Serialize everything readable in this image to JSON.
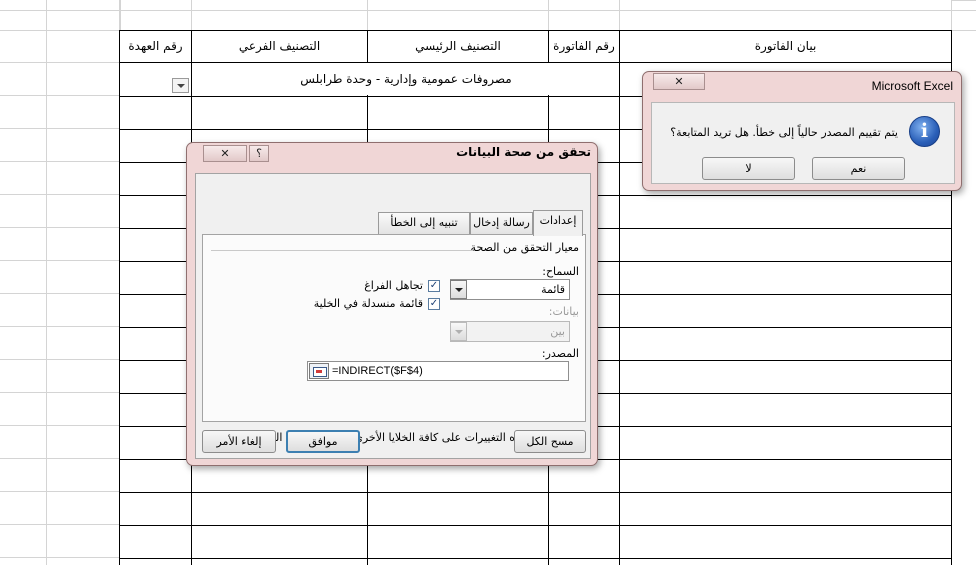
{
  "sheet": {
    "headers": {
      "custody_no": "رقم العهدة",
      "sub_category": "التصنيف الفرعي",
      "main_category": "التصنيف الرئيسي",
      "invoice_no": "رقم الفاتورة",
      "invoice_desc": "بيان الفاتورة"
    },
    "merged_cell_value": "مصروفات عمومية وإدارية - وحدة طرابلس"
  },
  "data_validation_dialog": {
    "title": "تحقق من صحة البيانات",
    "help_glyph": "؟",
    "close_glyph": "✕",
    "tabs": [
      {
        "label": "إعدادات",
        "active": true
      },
      {
        "label": "رسالة إدخال",
        "active": false
      },
      {
        "label": "تنبيه إلى الخطأ",
        "active": false
      }
    ],
    "criteria_heading": "معيار التحقق من الصحة",
    "allow_label": "السماح:",
    "allow_value": "قائمة",
    "ignore_blank_label": "تجاهل الفراغ",
    "ignore_blank_checked": true,
    "in_cell_dropdown_label": "قائمة منسدلة في الخلية",
    "in_cell_dropdown_checked": true,
    "data_label": "بيانات:",
    "data_value": "بين",
    "source_label": "المصدر:",
    "source_value": "=INDIRECT($F$4)",
    "apply_all_label": "تطبيق هذه التغييرات على كافة الخلايا الأخرى ذات الإعدادات المشابهة",
    "apply_all_checked": false,
    "clear_all_button": "مسح الكل",
    "ok_button": "موافق",
    "cancel_button": "إلغاء الأمر",
    "check_glyph": "✓"
  },
  "excel_message_box": {
    "title": "Microsoft Excel",
    "close_glyph": "✕",
    "icon": "info-icon",
    "icon_glyph": "i",
    "message": "يتم تقييم المصدر حالياً إلى خطأ. هل تريد المتابعة؟",
    "yes_button": "نعم",
    "no_button": "لا"
  }
}
